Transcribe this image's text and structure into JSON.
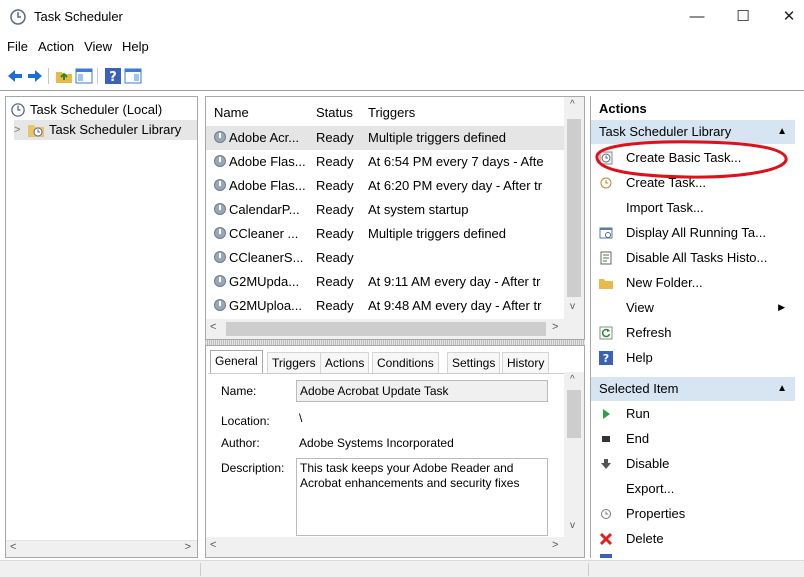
{
  "window": {
    "title": "Task Scheduler",
    "minimize": "—",
    "maximize": "☐",
    "close": "✕"
  },
  "menu": [
    "File",
    "Action",
    "View",
    "Help"
  ],
  "tree": {
    "items": [
      {
        "label": "Task Scheduler (Local)",
        "expander": ""
      },
      {
        "label": "Task Scheduler Library",
        "expander": ">"
      }
    ],
    "scroll_left": "<",
    "scroll_right": ">"
  },
  "tasks": {
    "columns": [
      "Name",
      "Status",
      "Triggers"
    ],
    "rows": [
      {
        "name": "Adobe Acr...",
        "status": "Ready",
        "triggers": "Multiple triggers defined"
      },
      {
        "name": "Adobe Flas...",
        "status": "Ready",
        "triggers": "At 6:54 PM every 7 days - Afte"
      },
      {
        "name": "Adobe Flas...",
        "status": "Ready",
        "triggers": "At 6:20 PM every day - After tr"
      },
      {
        "name": "CalendarP...",
        "status": "Ready",
        "triggers": "At system startup"
      },
      {
        "name": "CCleaner ...",
        "status": "Ready",
        "triggers": "Multiple triggers defined"
      },
      {
        "name": "CCleanerS...",
        "status": "Ready",
        "triggers": ""
      },
      {
        "name": "G2MUpda...",
        "status": "Ready",
        "triggers": "At 9:11 AM every day - After tr"
      },
      {
        "name": "G2MUploa...",
        "status": "Ready",
        "triggers": "At 9:48 AM every day - After tr"
      }
    ],
    "scroll_up": "^",
    "scroll_down": "v",
    "scroll_left": "<",
    "scroll_right": ">"
  },
  "details": {
    "tabs": [
      "General",
      "Triggers",
      "Actions",
      "Conditions",
      "Settings",
      "History"
    ],
    "selected_tab": "General",
    "name_label": "Name:",
    "name_value": "Adobe Acrobat Update Task",
    "location_label": "Location:",
    "location_value": "\\",
    "author_label": "Author:",
    "author_value": "Adobe Systems Incorporated",
    "description_label": "Description:",
    "description_value": "This task keeps your Adobe Reader and Acrobat enhancements and security fixes",
    "scroll_up": "^",
    "scroll_down": "v",
    "scroll_left": "<",
    "scroll_right": ">"
  },
  "actions": {
    "title": "Actions",
    "library_section": "Task Scheduler Library",
    "library_items": [
      {
        "label": "Create Basic Task...",
        "icon": "create-basic-task-icon",
        "submenu": ""
      },
      {
        "label": "Create Task...",
        "icon": "create-task-icon",
        "submenu": ""
      },
      {
        "label": "Import Task...",
        "icon": "",
        "submenu": ""
      },
      {
        "label": "Display All Running Ta...",
        "icon": "running-tasks-icon",
        "submenu": ""
      },
      {
        "label": "Disable All Tasks Histo...",
        "icon": "history-icon",
        "submenu": ""
      },
      {
        "label": "New Folder...",
        "icon": "folder-icon",
        "submenu": ""
      },
      {
        "label": "View",
        "icon": "",
        "submenu": "▶"
      },
      {
        "label": "Refresh",
        "icon": "refresh-icon",
        "submenu": ""
      },
      {
        "label": "Help",
        "icon": "help-icon",
        "submenu": ""
      }
    ],
    "selected_section": "Selected Item",
    "selected_items": [
      {
        "label": "Run",
        "icon": "run-icon"
      },
      {
        "label": "End",
        "icon": "end-icon"
      },
      {
        "label": "Disable",
        "icon": "disable-icon"
      },
      {
        "label": "Export...",
        "icon": ""
      },
      {
        "label": "Properties",
        "icon": "properties-icon"
      },
      {
        "label": "Delete",
        "icon": "delete-icon"
      }
    ],
    "collapse": "▲"
  },
  "colors": {
    "section_bg": "#d7e4f2",
    "highlight_ring": "#e0101a",
    "selected_row": "#e5e5e5"
  }
}
